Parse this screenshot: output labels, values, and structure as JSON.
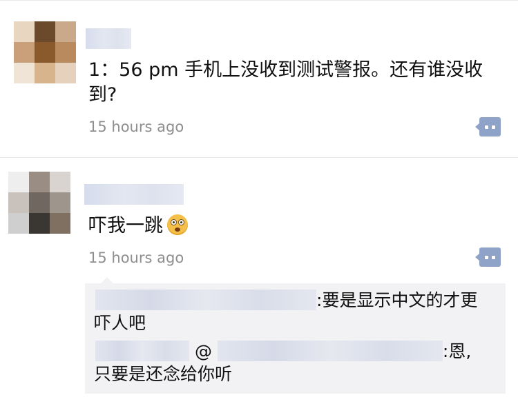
{
  "posts": [
    {
      "text": "1：56 pm 手机上没收到测试警报。还有谁没收到?",
      "time": "15 hours ago",
      "avatar_colors": [
        "#e8d6c0",
        "#6a4a2a",
        "#c9a98a",
        "#c9a07a",
        "#8a5a2c",
        "#b88a5e",
        "#efe4d6",
        "#d8b48c",
        "#e6d2bc"
      ]
    },
    {
      "text": "吓我一跳",
      "emoji": "astonished-face-emoji",
      "time": "15 hours ago",
      "avatar_colors": [
        "#eeeeee",
        "#9a8e84",
        "#d9d4cf",
        "#c9c2bc",
        "#6f6760",
        "#9e958c",
        "#cfcfcf",
        "#3a3631",
        "#7f7061"
      ],
      "replies": [
        {
          "separator": ":",
          "text": "要是显示中文的才更吓人吧"
        },
        {
          "at": "@",
          "separator": ":",
          "text": "恩,只要是还念给你听"
        }
      ]
    }
  ],
  "icons": {
    "comment_button": "comment-bubble-icon"
  },
  "colors": {
    "comment_icon": "#8fa2c7",
    "timestamp": "#8e8e8e",
    "reply_background": "#f2f2f4"
  }
}
